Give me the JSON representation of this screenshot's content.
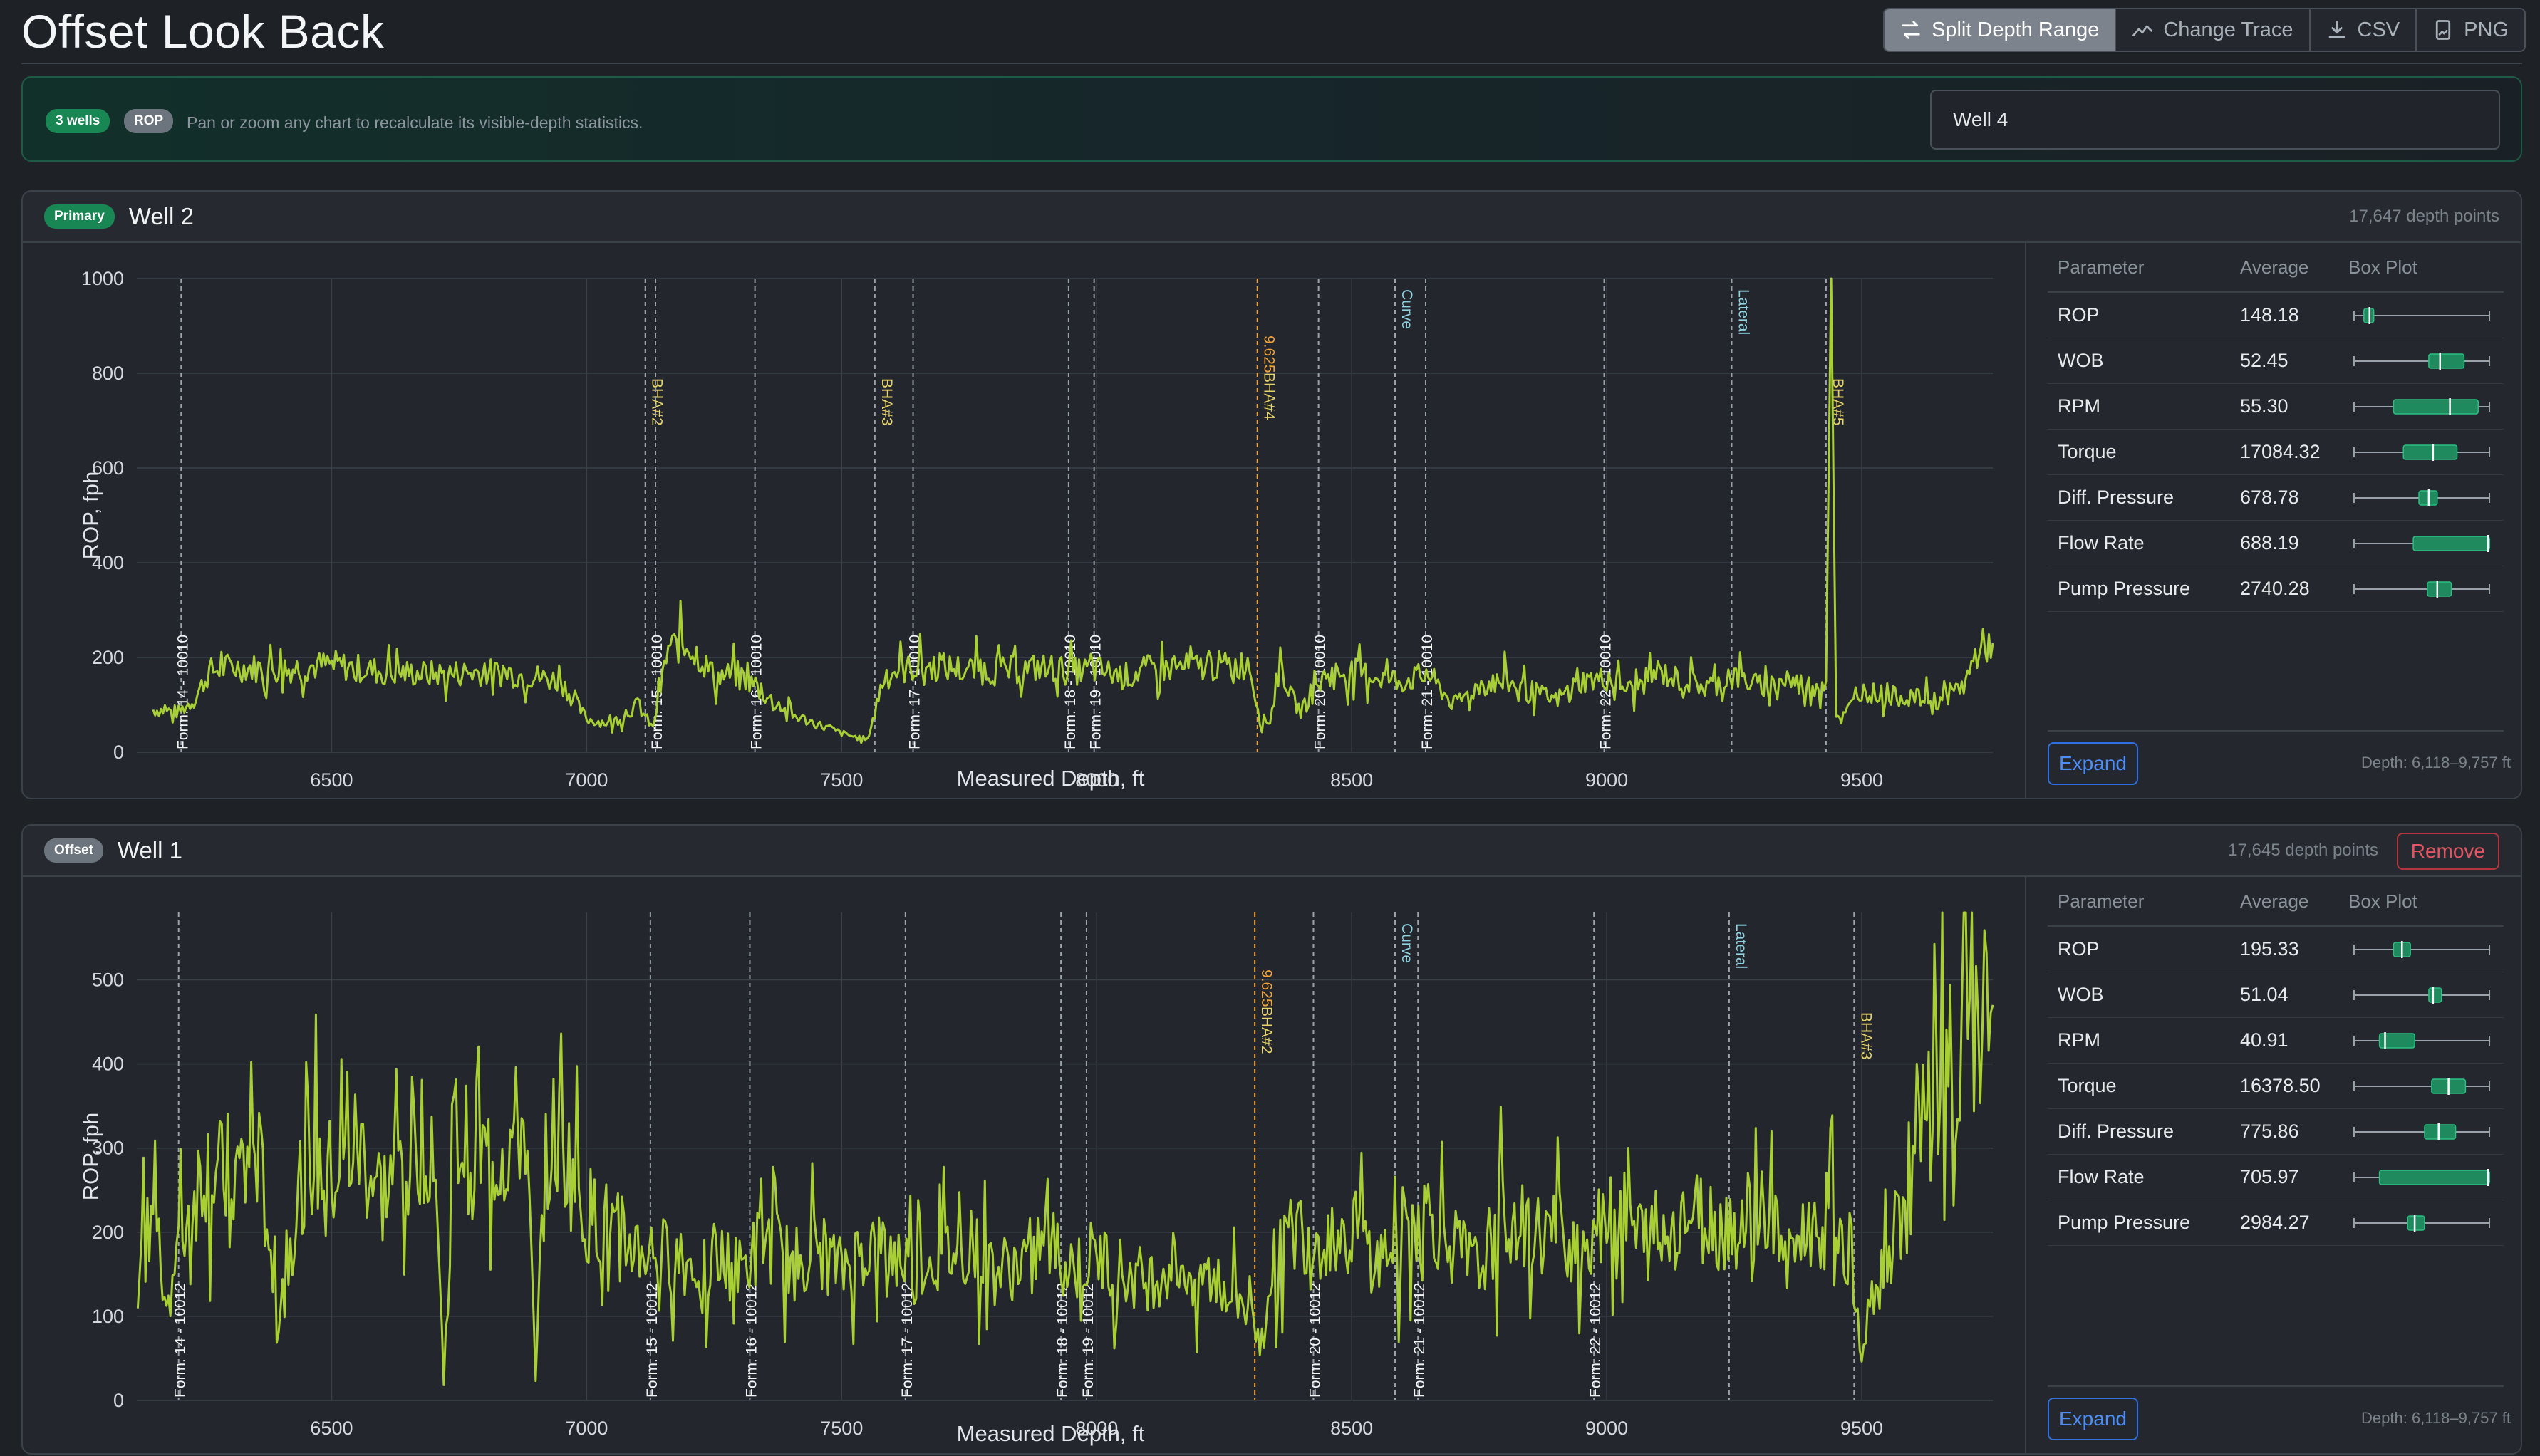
{
  "app": {
    "title": "Offset Look Back"
  },
  "toolbar": {
    "split_label": "Split Depth Range",
    "change_label": "Change Trace",
    "csv_label": "CSV",
    "png_label": "PNG"
  },
  "info": {
    "wells_badge": "3 wells",
    "trace_badge": "ROP",
    "message": "Pan or zoom any chart to recalculate its visible-depth statistics.",
    "well_input_value": "Well 4"
  },
  "colors": {
    "accent_green": "#198754",
    "trace": "#a8cf34",
    "bha_label": "#e6d36a",
    "casing_label": "#f0a23b",
    "section_label": "#8fd3e0",
    "remove": "#dc3545",
    "expand": "#2f6fe0"
  },
  "stats_headers": {
    "param": "Parameter",
    "avg": "Average",
    "box": "Box Plot"
  },
  "wells": [
    {
      "role": "Primary",
      "name": "Well 2",
      "depth_points": "17,647 depth points",
      "depth_range": "Depth: 6,118–9,757 ft",
      "expand_label": "Expand",
      "stats": [
        {
          "param": "ROP",
          "avg": "148.18",
          "box": {
            "min": 0.02,
            "q1": 0.09,
            "med": 0.13,
            "q3": 0.16,
            "max": 0.98
          }
        },
        {
          "param": "WOB",
          "avg": "52.45",
          "box": {
            "min": 0.02,
            "q1": 0.55,
            "med": 0.63,
            "q3": 0.8,
            "max": 0.98
          }
        },
        {
          "param": "RPM",
          "avg": "55.30",
          "box": {
            "min": 0.02,
            "q1": 0.3,
            "med": 0.7,
            "q3": 0.9,
            "max": 0.98
          }
        },
        {
          "param": "Torque",
          "avg": "17084.32",
          "box": {
            "min": 0.02,
            "q1": 0.37,
            "med": 0.58,
            "q3": 0.75,
            "max": 0.98
          }
        },
        {
          "param": "Diff. Pressure",
          "avg": "678.78",
          "box": {
            "min": 0.02,
            "q1": 0.48,
            "med": 0.55,
            "q3": 0.61,
            "max": 0.98
          }
        },
        {
          "param": "Flow Rate",
          "avg": "688.19",
          "box": {
            "min": 0.02,
            "q1": 0.44,
            "med": 0.97,
            "q3": 0.98,
            "max": 0.98
          }
        },
        {
          "param": "Pump Pressure",
          "avg": "2740.28",
          "box": {
            "min": 0.02,
            "q1": 0.54,
            "med": 0.61,
            "q3": 0.71,
            "max": 0.98
          }
        }
      ],
      "chart_data": {
        "type": "line",
        "title": "",
        "xlabel": "Measured Depth, ft",
        "ylabel": "ROP, fph",
        "xlim": [
          6118,
          9757
        ],
        "ylim": [
          0,
          1000
        ],
        "x_ticks": [
          6500,
          7000,
          7500,
          8000,
          8500,
          9000,
          9500
        ],
        "y_ticks": [
          0,
          200,
          400,
          600,
          800,
          1000
        ],
        "grid": true,
        "series": [
          {
            "x": [
              6150,
              6200,
              6230,
              6260,
              6300,
              6400,
              6500,
              6600,
              6700,
              6800,
              6900,
              6950,
              7000,
              7050,
              7100,
              7130,
              7160,
              7200,
              7250,
              7300,
              7350,
              7400,
              7450,
              7500,
              7550,
              7580,
              7600,
              7650,
              7700,
              7800,
              7900,
              7950,
              8000,
              8050,
              8100,
              8200,
              8300,
              8320,
              8340,
              8360,
              8380,
              8400,
              8450,
              8500,
              8550,
              8600,
              8650,
              8700,
              8750,
              8800,
              8850,
              8900,
              8950,
              9000,
              9050,
              9100,
              9150,
              9200,
              9250,
              9300,
              9350,
              9400,
              9430,
              9440,
              9450,
              9460,
              9500,
              9550,
              9600,
              9650,
              9700,
              9730,
              9757
            ],
            "y": [
              90,
              85,
              110,
              170,
              180,
              175,
              185,
              170,
              165,
              170,
              160,
              150,
              70,
              60,
              100,
              50,
              220,
              230,
              160,
              165,
              120,
              80,
              60,
              40,
              25,
              150,
              170,
              180,
              180,
              170,
              180,
              170,
              175,
              160,
              175,
              180,
              185,
              70,
              65,
              190,
              120,
              85,
              165,
              170,
              160,
              150,
              165,
              100,
              140,
              150,
              130,
              110,
              150,
              155,
              130,
              170,
              150,
              140,
              160,
              140,
              150,
              140,
              150,
              1000,
              80,
              70,
              130,
              120,
              115,
              110,
              140,
              220,
              230
            ]
          }
        ],
        "markers": [
          {
            "x": 6205,
            "label": "Form. 14 - 10010",
            "kind": "form"
          },
          {
            "x": 7115,
            "label": "BHA#2",
            "kind": "bha"
          },
          {
            "x": 7135,
            "label": "Form. 15 - 10010",
            "kind": "form"
          },
          {
            "x": 7330,
            "label": "Form. 16 - 10010",
            "kind": "form"
          },
          {
            "x": 7565,
            "label": "BHA#3",
            "kind": "bha"
          },
          {
            "x": 7640,
            "label": "Form. 17 - 10010",
            "kind": "form"
          },
          {
            "x": 7945,
            "label": "Form. 18 - 10010",
            "kind": "form"
          },
          {
            "x": 7995,
            "label": "Form. 19 - 10010",
            "kind": "form"
          },
          {
            "x": 8315,
            "label": "BHA#4",
            "kind": "bha",
            "casing": "9.625"
          },
          {
            "x": 8435,
            "label": "Form. 20 - 10010",
            "kind": "form"
          },
          {
            "x": 8585,
            "label": "Curve",
            "kind": "section"
          },
          {
            "x": 8645,
            "label": "Form. 21 - 10010",
            "kind": "form"
          },
          {
            "x": 8995,
            "label": "Form. 22 - 10010",
            "kind": "form"
          },
          {
            "x": 9245,
            "label": "Lateral",
            "kind": "section"
          },
          {
            "x": 9430,
            "label": "BHA#5",
            "kind": "bha"
          }
        ]
      }
    },
    {
      "role": "Offset",
      "name": "Well 1",
      "depth_points": "17,645 depth points",
      "remove_label": "Remove",
      "depth_range": "Depth: 6,118–9,757 ft",
      "expand_label": "Expand",
      "stats": [
        {
          "param": "ROP",
          "avg": "195.33",
          "box": {
            "min": 0.02,
            "q1": 0.3,
            "med": 0.36,
            "q3": 0.42,
            "max": 0.98
          }
        },
        {
          "param": "WOB",
          "avg": "51.04",
          "box": {
            "min": 0.02,
            "q1": 0.55,
            "med": 0.58,
            "q3": 0.64,
            "max": 0.98
          }
        },
        {
          "param": "RPM",
          "avg": "40.91",
          "box": {
            "min": 0.02,
            "q1": 0.2,
            "med": 0.24,
            "q3": 0.45,
            "max": 0.98
          }
        },
        {
          "param": "Torque",
          "avg": "16378.50",
          "box": {
            "min": 0.02,
            "q1": 0.57,
            "med": 0.69,
            "q3": 0.81,
            "max": 0.98
          }
        },
        {
          "param": "Diff. Pressure",
          "avg": "775.86",
          "box": {
            "min": 0.02,
            "q1": 0.52,
            "med": 0.62,
            "q3": 0.74,
            "max": 0.98
          }
        },
        {
          "param": "Flow Rate",
          "avg": "705.97",
          "box": {
            "min": 0.02,
            "q1": 0.2,
            "med": 0.97,
            "q3": 0.98,
            "max": 0.98
          }
        },
        {
          "param": "Pump Pressure",
          "avg": "2984.27",
          "box": {
            "min": 0.02,
            "q1": 0.4,
            "med": 0.45,
            "q3": 0.52,
            "max": 0.98
          }
        }
      ],
      "chart_data": {
        "type": "line",
        "title": "",
        "xlabel": "Measured Depth, ft",
        "ylabel": "ROP, fph",
        "xlim": [
          6118,
          9757
        ],
        "ylim": [
          0,
          580
        ],
        "x_ticks": [
          6500,
          7000,
          7500,
          8000,
          8500,
          9000,
          9500
        ],
        "y_ticks": [
          0,
          100,
          200,
          300,
          400,
          500
        ],
        "grid": true,
        "series": [
          {
            "x": [
              6120,
              6150,
              6180,
              6200,
              6250,
              6300,
              6350,
              6400,
              6450,
              6500,
              6550,
              6600,
              6650,
              6700,
              6720,
              6740,
              6800,
              6850,
              6880,
              6900,
              6920,
              6950,
              7000,
              7050,
              7100,
              7150,
              7200,
              7250,
              7300,
              7350,
              7400,
              7450,
              7500,
              7550,
              7600,
              7650,
              7700,
              7750,
              7800,
              7850,
              7900,
              7950,
              8000,
              8050,
              8100,
              8150,
              8200,
              8250,
              8300,
              8320,
              8340,
              8360,
              8400,
              8450,
              8500,
              8550,
              8600,
              8650,
              8700,
              8750,
              8800,
              8850,
              8900,
              8950,
              9000,
              9050,
              9100,
              9150,
              9200,
              9250,
              9300,
              9350,
              9400,
              9450,
              9480,
              9500,
              9520,
              9550,
              9600,
              9620,
              9650,
              9670,
              9680,
              9700,
              9720,
              9757
            ],
            "y": [
              150,
              230,
              120,
              180,
              280,
              250,
              300,
              120,
              290,
              260,
              300,
              240,
              300,
              320,
              20,
              310,
              280,
              300,
              330,
              20,
              310,
              300,
              220,
              200,
              180,
              170,
              160,
              170,
              150,
              190,
              160,
              180,
              150,
              180,
              170,
              160,
              170,
              180,
              150,
              160,
              190,
              150,
              170,
              150,
              140,
              160,
              150,
              130,
              120,
              60,
              150,
              180,
              200,
              190,
              210,
              160,
              200,
              220,
              180,
              150,
              230,
              190,
              200,
              180,
              240,
              200,
              180,
              220,
              210,
              200,
              230,
              180,
              200,
              220,
              170,
              60,
              120,
              180,
              250,
              320,
              400,
              500,
              250,
              480,
              460,
              470
            ]
          }
        ],
        "markers": [
          {
            "x": 6200,
            "label": "Form. 14 - 10012",
            "kind": "form"
          },
          {
            "x": 7125,
            "label": "Form. 15 - 10012",
            "kind": "form"
          },
          {
            "x": 7320,
            "label": "Form. 16 - 10012",
            "kind": "form"
          },
          {
            "x": 7625,
            "label": "Form. 17 - 10012",
            "kind": "form"
          },
          {
            "x": 7930,
            "label": "Form. 18 - 10012",
            "kind": "form"
          },
          {
            "x": 7980,
            "label": "Form. 19 - 10012",
            "kind": "form"
          },
          {
            "x": 8310,
            "label": "BHA#2",
            "kind": "bha",
            "casing": "9.625"
          },
          {
            "x": 8425,
            "label": "Form. 20 - 10012",
            "kind": "form"
          },
          {
            "x": 8585,
            "label": "Curve",
            "kind": "section"
          },
          {
            "x": 8630,
            "label": "Form. 21 - 10012",
            "kind": "form"
          },
          {
            "x": 8975,
            "label": "Form. 22 - 10012",
            "kind": "form"
          },
          {
            "x": 9240,
            "label": "Lateral",
            "kind": "section"
          },
          {
            "x": 9485,
            "label": "BHA#3",
            "kind": "bha"
          }
        ]
      }
    }
  ]
}
